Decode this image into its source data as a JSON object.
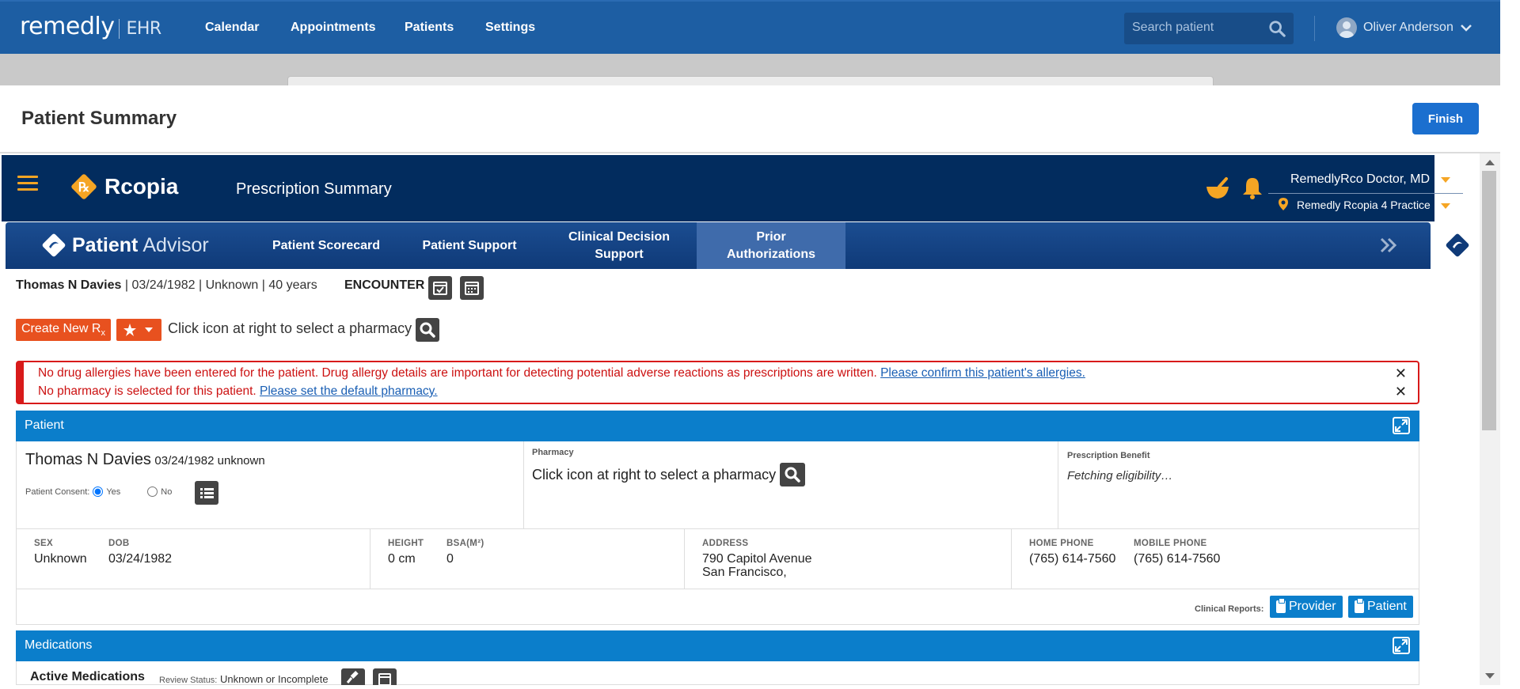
{
  "topbar": {
    "logo": "remedly",
    "logo_suffix": "EHR",
    "nav": [
      "Calendar",
      "Appointments",
      "Patients",
      "Settings"
    ],
    "search_placeholder": "Search patient",
    "user_name": "Oliver Anderson"
  },
  "page": {
    "title": "Patient Summary",
    "finish_label": "Finish"
  },
  "rcopia": {
    "brand": "Rcopia",
    "title": "Prescription Summary",
    "doctor": "RemedlyRco Doctor, MD",
    "practice": "Remedly Rcopia 4 Practice",
    "accent": "#f5a524"
  },
  "advisor": {
    "brand_bold": "Patient",
    "brand_light": "Advisor",
    "tabs": [
      {
        "label": "Patient Scorecard"
      },
      {
        "label": "Patient Support"
      },
      {
        "label": "Clinical Decision Support"
      },
      {
        "label": "Prior Authorizations"
      }
    ]
  },
  "patient_line": {
    "name": "Thomas N Davies",
    "details": "| 03/24/1982 | Unknown | 40 years",
    "encounter": "ENCOUNTER"
  },
  "actions": {
    "create_rx": "Create New R",
    "create_rx_sub": "x",
    "pharmacy_hint": "Click icon at right to select a pharmacy"
  },
  "alerts": [
    {
      "text": "No drug allergies have been entered for the patient. Drug allergy details are important for detecting potential adverse reactions as prescriptions are written.",
      "link": "Please confirm this patient's allergies."
    },
    {
      "text": "No pharmacy is selected for this patient.",
      "link": "Please set the default pharmacy."
    }
  ],
  "patient_panel": {
    "header": "Patient",
    "name": "Thomas N Davies",
    "dob_inline": "03/24/1982 unknown",
    "consent_label": "Patient Consent:",
    "consent_yes": "Yes",
    "consent_no": "No",
    "pharmacy_label": "Pharmacy",
    "pharmacy_text": "Click icon at right to select a pharmacy",
    "benefit_label": "Prescription Benefit",
    "benefit_text": "Fetching eligibility…",
    "sex_label": "SEX",
    "sex": "Unknown",
    "dob_label": "DOB",
    "dob": "03/24/1982",
    "height_label": "HEIGHT",
    "height": "0 cm",
    "bsa_label": "BSA(M²)",
    "bsa": "0",
    "address_label": "ADDRESS",
    "address1": "790 Capitol Avenue",
    "address2": "San Francisco,",
    "home_phone_label": "HOME PHONE",
    "home_phone": "(765) 614-7560",
    "mobile_phone_label": "MOBILE PHONE",
    "mobile_phone": "(765) 614-7560",
    "clinical_reports_label": "Clinical Reports:",
    "provider_btn": "Provider",
    "patient_btn": "Patient"
  },
  "medications": {
    "header": "Medications",
    "active_title": "Active Medications",
    "review_label": "Review Status:",
    "review_value": "Unknown or Incomplete"
  }
}
